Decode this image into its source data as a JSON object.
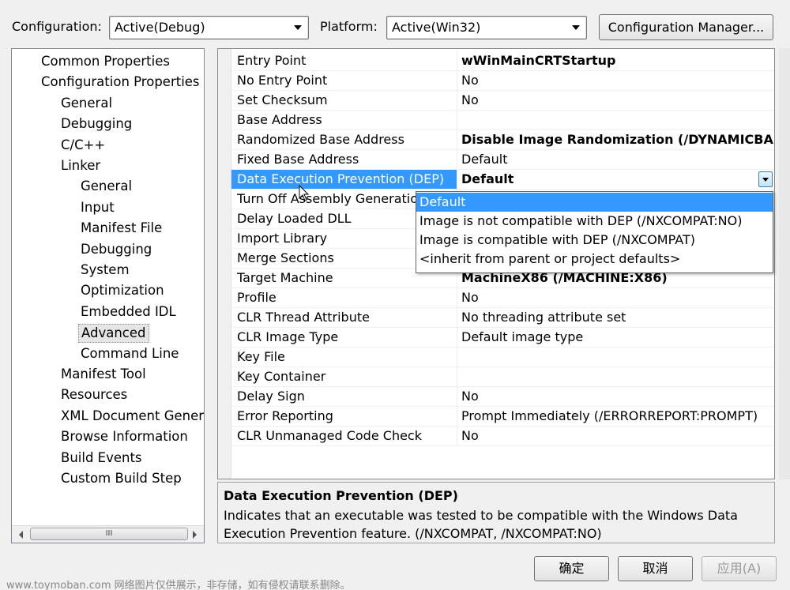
{
  "toolbar": {
    "configuration_label": "Configuration:",
    "configuration_value": "Active(Debug)",
    "platform_label": "Platform:",
    "platform_value": "Active(Win32)",
    "config_manager_button": "Configuration Manager..."
  },
  "tree": {
    "items": [
      {
        "label": "Common Properties",
        "level": 0
      },
      {
        "label": "Configuration Properties",
        "level": 0
      },
      {
        "label": "General",
        "level": 1
      },
      {
        "label": "Debugging",
        "level": 1
      },
      {
        "label": "C/C++",
        "level": 1
      },
      {
        "label": "Linker",
        "level": 1
      },
      {
        "label": "General",
        "level": 2
      },
      {
        "label": "Input",
        "level": 2
      },
      {
        "label": "Manifest File",
        "level": 2
      },
      {
        "label": "Debugging",
        "level": 2
      },
      {
        "label": "System",
        "level": 2
      },
      {
        "label": "Optimization",
        "level": 2
      },
      {
        "label": "Embedded IDL",
        "level": 2
      },
      {
        "label": "Advanced",
        "level": 2,
        "selected": true
      },
      {
        "label": "Command Line",
        "level": 2
      },
      {
        "label": "Manifest Tool",
        "level": 1
      },
      {
        "label": "Resources",
        "level": 1
      },
      {
        "label": "XML Document Generat",
        "level": 1
      },
      {
        "label": "Browse Information",
        "level": 1
      },
      {
        "label": "Build Events",
        "level": 1
      },
      {
        "label": "Custom Build Step",
        "level": 1
      }
    ],
    "scroll_thumb_glyph": "III"
  },
  "properties": [
    {
      "name": "Entry Point",
      "value": "wWinMainCRTStartup",
      "bold": true
    },
    {
      "name": "No Entry Point",
      "value": "No"
    },
    {
      "name": "Set Checksum",
      "value": "No"
    },
    {
      "name": "Base Address",
      "value": ""
    },
    {
      "name": "Randomized Base Address",
      "value": "Disable Image Randomization (/DYNAMICBASE:NO)",
      "bold": true
    },
    {
      "name": "Fixed Base Address",
      "value": "Default"
    },
    {
      "name": "Data Execution Prevention (DEP)",
      "value": "Default",
      "bold": true,
      "selected": true
    },
    {
      "name": "Turn Off Assembly Generation",
      "value": ""
    },
    {
      "name": "Delay Loaded DLL",
      "value": ""
    },
    {
      "name": "Import Library",
      "value": ""
    },
    {
      "name": "Merge Sections",
      "value": ""
    },
    {
      "name": "Target Machine",
      "value": "MachineX86 (/MACHINE:X86)",
      "bold": true
    },
    {
      "name": "Profile",
      "value": "No"
    },
    {
      "name": "CLR Thread Attribute",
      "value": "No threading attribute set"
    },
    {
      "name": "CLR Image Type",
      "value": "Default image type"
    },
    {
      "name": "Key File",
      "value": ""
    },
    {
      "name": "Key Container",
      "value": ""
    },
    {
      "name": "Delay Sign",
      "value": "No"
    },
    {
      "name": "Error Reporting",
      "value": "Prompt Immediately (/ERRORREPORT:PROMPT)"
    },
    {
      "name": "CLR Unmanaged Code Check",
      "value": "No"
    }
  ],
  "dropdown": {
    "options": [
      {
        "label": "Default",
        "selected": true
      },
      {
        "label": "Image is not compatible with DEP (/NXCOMPAT:NO)"
      },
      {
        "label": "Image is compatible with DEP (/NXCOMPAT)"
      },
      {
        "label": "<inherit from parent or project defaults>"
      }
    ]
  },
  "description": {
    "title": "Data Execution Prevention (DEP)",
    "body": "Indicates that an executable was tested to be compatible with the Windows Data Execution Prevention feature. (/NXCOMPAT, /NXCOMPAT:NO)"
  },
  "buttons": {
    "ok": "确定",
    "cancel": "取消",
    "apply": "应用(A)"
  },
  "watermark": "www.toymoban.com 网络图片仅供展示，非存储，如有侵权请联系删除。",
  "colors": {
    "selection": "#3399ff",
    "background": "#f0f0f0"
  }
}
